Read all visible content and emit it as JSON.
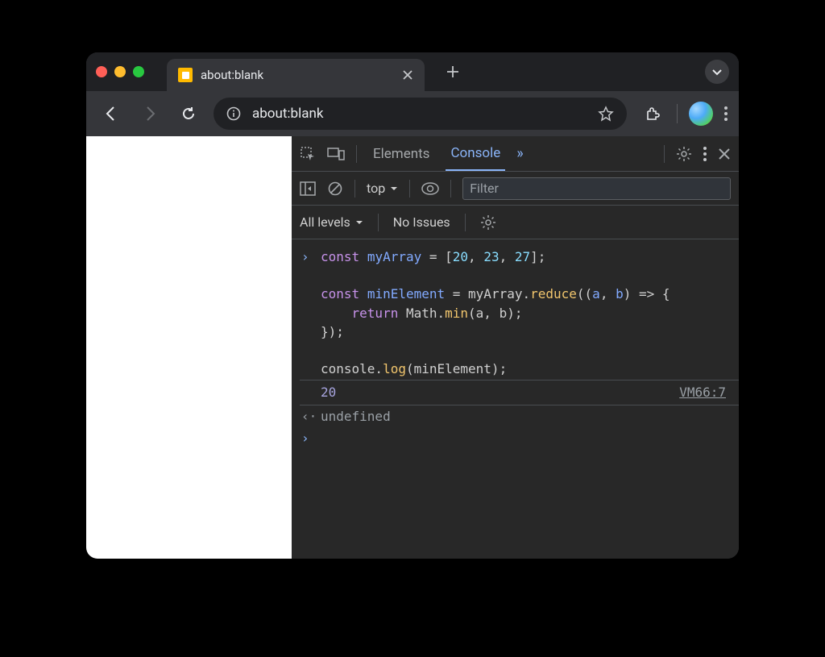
{
  "tab": {
    "title": "about:blank"
  },
  "omnibox": {
    "url": "about:blank"
  },
  "devtools": {
    "tabs": {
      "elements": "Elements",
      "console": "Console"
    },
    "context": "top",
    "filter_placeholder": "Filter",
    "levels": "All levels",
    "issues": "No Issues"
  },
  "console": {
    "input_code": "const myArray = [20, 23, 27];\n\nconst minElement = myArray.reduce((a, b) => {\n    return Math.min(a, b);\n});\n\nconsole.log(minElement);",
    "code_tokens": {
      "l1_kw": "const",
      "l1_var": "myArray",
      "l1_eq": " = [",
      "l1_n1": "20",
      "l1_c1": ", ",
      "l1_n2": "23",
      "l1_c2": ", ",
      "l1_n3": "27",
      "l1_end": "];",
      "l3_kw": "const",
      "l3_var": "minElement",
      "l3_eq": " = myArray.",
      "l3_fn": "reduce",
      "l3_open": "((",
      "l3_a": "a",
      "l3_c": ", ",
      "l3_b": "b",
      "l3_arrow": ") => {",
      "l4_pad": "    ",
      "l4_kw": "return",
      "l4_math": " Math.",
      "l4_fn": "min",
      "l4_args": "(a, b);",
      "l5": "});",
      "l7a": "console.",
      "l7fn": "log",
      "l7b": "(minElement);"
    },
    "log_output": "20",
    "log_source": "VM66:7",
    "return_value": "undefined"
  }
}
